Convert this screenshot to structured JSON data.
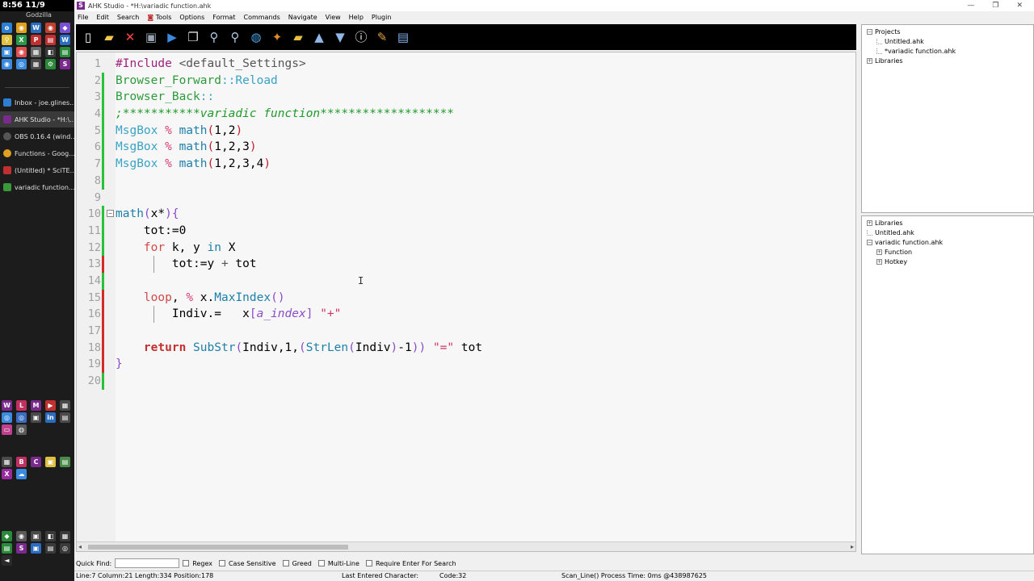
{
  "taskbar": {
    "clock": "8:56 11/9",
    "user": "Godzilla",
    "tasks": [
      {
        "label": "Inbox - joe.glines...",
        "color": "#2d7fd3"
      },
      {
        "label": "AHK Studio - *H:\\...",
        "color": "#7a2a8c"
      },
      {
        "label": "OBS 0.16.4 (wind...",
        "color": "#555555"
      },
      {
        "label": "Functions - Goog...",
        "color": "#e0a020"
      },
      {
        "label": "(Untitled) * SciTE...",
        "color": "#c03030"
      },
      {
        "label": "variadic function...",
        "color": "#3a9a3a"
      }
    ]
  },
  "window": {
    "title": "AHK Studio - *H:\\variadic function.ahk",
    "controls": [
      "—",
      "❐",
      "✕"
    ]
  },
  "menu": [
    "File",
    "Edit",
    "Search",
    "Tools",
    "Options",
    "Format",
    "Commands",
    "Navigate",
    "View",
    "Help",
    "Plugin"
  ],
  "toolbar": [
    {
      "name": "new-file-icon",
      "glyph": "▯",
      "color": "#ffffff"
    },
    {
      "name": "open-folder-icon",
      "glyph": "▰",
      "color": "#f2c94c"
    },
    {
      "name": "close-file-icon",
      "glyph": "✕",
      "color": "#ff4444"
    },
    {
      "name": "save-icon",
      "glyph": "▣",
      "color": "#9aa4b0"
    },
    {
      "name": "run-icon",
      "glyph": "▶",
      "color": "#3a8be0"
    },
    {
      "name": "copy-icon",
      "glyph": "❐",
      "color": "#dddddd"
    },
    {
      "name": "search-icon",
      "glyph": "⚲",
      "color": "#b0c8e0"
    },
    {
      "name": "replace-icon",
      "glyph": "⚲",
      "color": "#b0c8e0"
    },
    {
      "name": "globe-icon",
      "glyph": "◍",
      "color": "#4aa0e0"
    },
    {
      "name": "tools-icon",
      "glyph": "✦",
      "color": "#e08a30"
    },
    {
      "name": "add-folder-icon",
      "glyph": "▰",
      "color": "#e8c040"
    },
    {
      "name": "up-icon",
      "glyph": "▲",
      "color": "#8fb8e8"
    },
    {
      "name": "down-icon",
      "glyph": "▼",
      "color": "#8fb8e8"
    },
    {
      "name": "info-icon",
      "glyph": "ⓘ",
      "color": "#ffffff"
    },
    {
      "name": "plugin-icon",
      "glyph": "✎",
      "color": "#e0a040"
    },
    {
      "name": "settings-icon",
      "glyph": "▤",
      "color": "#7fb0e8"
    }
  ],
  "code_lines": [
    {
      "n": "1",
      "mark": "none",
      "segments": [
        {
          "c": "kw-dir",
          "t": "#Include "
        },
        {
          "c": "kw-op",
          "t": "<default_Settings>"
        }
      ]
    },
    {
      "n": "2",
      "mark": "green",
      "segments": [
        {
          "c": "kw-hot",
          "t": "Browser_Forward"
        },
        {
          "c": "kw-cmd",
          "t": "::Reload"
        }
      ]
    },
    {
      "n": "3",
      "mark": "green",
      "segments": [
        {
          "c": "kw-hot",
          "t": "Browser_Back"
        },
        {
          "c": "kw-cmd",
          "t": "::"
        }
      ]
    },
    {
      "n": "4",
      "mark": "green",
      "segments": [
        {
          "c": "kw-cmt",
          "t": ";***********variadic function*******************"
        }
      ]
    },
    {
      "n": "5",
      "mark": "green",
      "segments": [
        {
          "c": "kw-cmd",
          "t": "MsgBox "
        },
        {
          "c": "kw-pct",
          "t": "% "
        },
        {
          "c": "kw-fn",
          "t": "math"
        },
        {
          "c": "kw-par",
          "t": "("
        },
        {
          "c": "kw-num",
          "t": "1,2"
        },
        {
          "c": "kw-par",
          "t": ")"
        }
      ]
    },
    {
      "n": "6",
      "mark": "green",
      "segments": [
        {
          "c": "kw-cmd",
          "t": "MsgBox "
        },
        {
          "c": "kw-pct",
          "t": "% "
        },
        {
          "c": "kw-fn",
          "t": "math"
        },
        {
          "c": "kw-par",
          "t": "("
        },
        {
          "c": "kw-num",
          "t": "1,2,3"
        },
        {
          "c": "kw-par",
          "t": ")"
        }
      ]
    },
    {
      "n": "7",
      "mark": "green",
      "segments": [
        {
          "c": "kw-cmd",
          "t": "MsgBox "
        },
        {
          "c": "kw-pct",
          "t": "% "
        },
        {
          "c": "kw-fn",
          "t": "math"
        },
        {
          "c": "kw-par",
          "t": "("
        },
        {
          "c": "kw-num",
          "t": "1,2,3,4"
        },
        {
          "c": "kw-par",
          "t": ")"
        }
      ]
    },
    {
      "n": "8",
      "mark": "green",
      "segments": []
    },
    {
      "n": "9",
      "mark": "none",
      "segments": []
    },
    {
      "n": "10",
      "mark": "green",
      "fold": true,
      "segments": [
        {
          "c": "kw-fn",
          "t": "math"
        },
        {
          "c": "kw-brace",
          "t": "("
        },
        {
          "c": "kw-num",
          "t": "x*"
        },
        {
          "c": "kw-brace",
          "t": "){"
        }
      ]
    },
    {
      "n": "11",
      "mark": "green",
      "segments": [
        {
          "c": "kw-num",
          "t": "    tot:=0"
        }
      ]
    },
    {
      "n": "12",
      "mark": "green",
      "segments": [
        {
          "c": "kw-num",
          "t": "    "
        },
        {
          "c": "kw-flow",
          "t": "for"
        },
        {
          "c": "kw-num",
          "t": " k, y "
        },
        {
          "c": "kw-fn",
          "t": "in"
        },
        {
          "c": "kw-num",
          "t": " X"
        }
      ]
    },
    {
      "n": "13",
      "mark": "red",
      "guide": true,
      "segments": [
        {
          "c": "kw-num",
          "t": "        tot:=y "
        },
        {
          "c": "kw-op",
          "t": "+"
        },
        {
          "c": "kw-num",
          "t": " tot"
        }
      ]
    },
    {
      "n": "14",
      "mark": "green",
      "segments": []
    },
    {
      "n": "15",
      "mark": "red",
      "segments": [
        {
          "c": "kw-num",
          "t": "    "
        },
        {
          "c": "kw-flow",
          "t": "loop"
        },
        {
          "c": "kw-num",
          "t": ", "
        },
        {
          "c": "kw-pct",
          "t": "%"
        },
        {
          "c": "kw-num",
          "t": " x."
        },
        {
          "c": "kw-meth",
          "t": "MaxIndex"
        },
        {
          "c": "kw-brace",
          "t": "()"
        }
      ]
    },
    {
      "n": "16",
      "mark": "red",
      "guide": true,
      "segments": [
        {
          "c": "kw-num",
          "t": "        Indiv.=   x"
        },
        {
          "c": "kw-brace",
          "t": "["
        },
        {
          "c": "kw-var",
          "t": "a_index"
        },
        {
          "c": "kw-brace",
          "t": "]"
        },
        {
          "c": "kw-num",
          "t": " "
        },
        {
          "c": "kw-str",
          "t": "\"+\""
        }
      ]
    },
    {
      "n": "17",
      "mark": "red",
      "segments": []
    },
    {
      "n": "18",
      "mark": "red",
      "segments": [
        {
          "c": "kw-num",
          "t": "    "
        },
        {
          "c": "kw-ret",
          "t": "return"
        },
        {
          "c": "kw-num",
          "t": " "
        },
        {
          "c": "kw-fn",
          "t": "SubStr"
        },
        {
          "c": "kw-brace",
          "t": "("
        },
        {
          "c": "kw-num",
          "t": "Indiv,1,"
        },
        {
          "c": "kw-brace",
          "t": "("
        },
        {
          "c": "kw-fn",
          "t": "StrLen"
        },
        {
          "c": "kw-brace",
          "t": "("
        },
        {
          "c": "kw-num",
          "t": "Indiv"
        },
        {
          "c": "kw-brace",
          "t": ")"
        },
        {
          "c": "kw-num",
          "t": "-1"
        },
        {
          "c": "kw-brace",
          "t": "))"
        },
        {
          "c": "kw-num",
          "t": " "
        },
        {
          "c": "kw-str",
          "t": "\"=\""
        },
        {
          "c": "kw-num",
          "t": " tot"
        }
      ]
    },
    {
      "n": "19",
      "mark": "red",
      "segments": [
        {
          "c": "kw-brace",
          "t": "}"
        }
      ]
    },
    {
      "n": "20",
      "mark": "green",
      "segments": []
    }
  ],
  "projects_panel": {
    "nodes": [
      {
        "label": "Projects",
        "indent": 0,
        "expander": "−"
      },
      {
        "label": "Untitled.ahk",
        "indent": 1,
        "expander": ""
      },
      {
        "label": "*variadic function.ahk",
        "indent": 1,
        "expander": ""
      },
      {
        "label": "Libraries",
        "indent": 0,
        "expander": "+"
      }
    ]
  },
  "code_explorer": {
    "nodes": [
      {
        "label": "Libraries",
        "indent": 0,
        "expander": "+"
      },
      {
        "label": "Untitled.ahk",
        "indent": 0,
        "expander": ""
      },
      {
        "label": "variadic function.ahk",
        "indent": 0,
        "expander": "−"
      },
      {
        "label": "Function",
        "indent": 1,
        "expander": "+"
      },
      {
        "label": "Hotkey",
        "indent": 1,
        "expander": "+"
      }
    ]
  },
  "quickfind": {
    "label": "Quick Find:",
    "value": "",
    "options": [
      "Regex",
      "Case Sensitive",
      "Greed",
      "Multi-Line",
      "Require Enter For Search"
    ]
  },
  "statusbar": {
    "position": "Line:7 Column:21 Length:334 Position:178",
    "last_char": "Last Entered Character:",
    "code": "Code:32",
    "timing": "Scan_Line() Process Time: 0ms @438987625"
  }
}
